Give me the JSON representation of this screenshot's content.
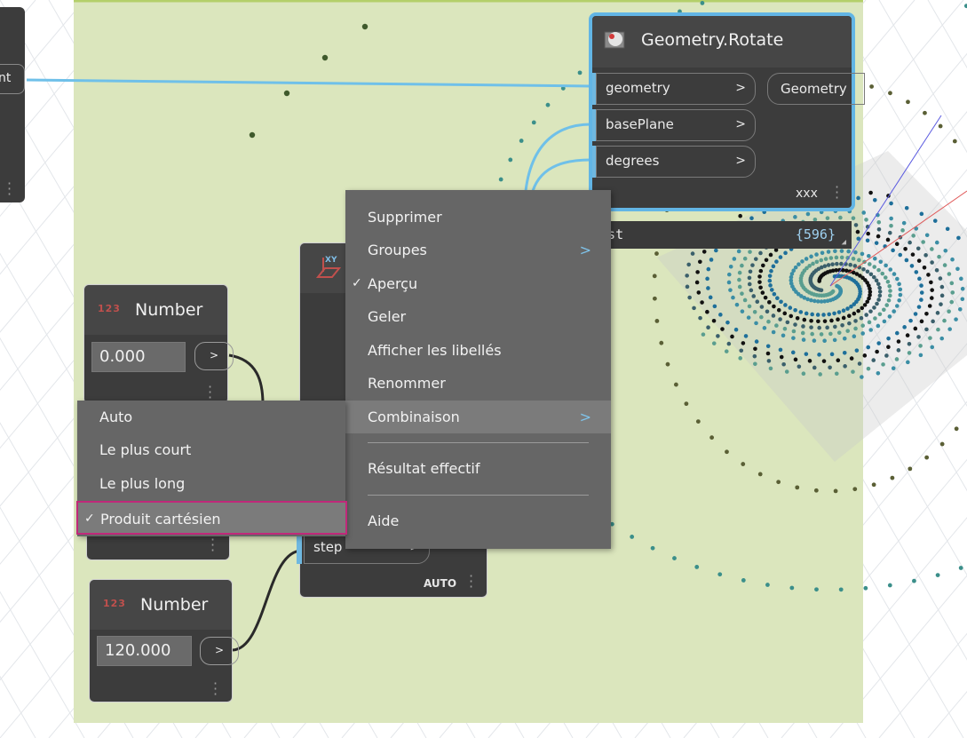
{
  "colors": {
    "canvas_bg": "#ffffff",
    "group_bg": "#dbe6bd",
    "node_bg": "#3c3c3c",
    "node_header": "#545454",
    "selection_border": "#62b5e5",
    "wire": "#6fc0e9",
    "menu_bg": "#666666",
    "menu_highlight": "#7b7b7b",
    "highlight_box": "#c0297a",
    "number_icon": "#c0504d"
  },
  "left_node": {
    "port_text": "nt"
  },
  "rotate_node": {
    "title": "Geometry.Rotate",
    "icon": "geometry-rotate-icon",
    "inputs": [
      {
        "label": "geometry",
        "chevron": ">"
      },
      {
        "label": "basePlane",
        "chevron": ">"
      },
      {
        "label": "degrees",
        "chevron": ">"
      }
    ],
    "output": "Geometry",
    "lacing": "xxx",
    "preview": {
      "label": "List",
      "count": "{596}"
    }
  },
  "number_node_1": {
    "icon_text": "123",
    "title": "Number",
    "value": "0.000",
    "arrow": ">"
  },
  "number_node_2": {
    "icon_text": "123",
    "title": "Number",
    "value": "120.000",
    "arrow": ">"
  },
  "middle_node": {
    "icon_text": "XY",
    "port_label": "step",
    "port_chevron": ">",
    "lacing": "AUTO"
  },
  "context_menu": {
    "items": [
      {
        "label": "Supprimer",
        "checked": false,
        "submenu": false
      },
      {
        "label": "Groupes",
        "checked": false,
        "submenu": true
      },
      {
        "label": "Aperçu",
        "checked": true,
        "submenu": false
      },
      {
        "label": "Geler",
        "checked": false,
        "submenu": false
      },
      {
        "label": "Afficher les libellés",
        "checked": false,
        "submenu": false
      },
      {
        "label": "Renommer",
        "checked": false,
        "submenu": false
      },
      {
        "label": "Combinaison",
        "checked": false,
        "submenu": true,
        "highlighted": true
      },
      {
        "label": "Résultat effectif",
        "checked": false,
        "submenu": false
      },
      {
        "label": "Aide",
        "checked": false,
        "submenu": false
      }
    ],
    "check_glyph": "✓",
    "submenu_glyph": ">"
  },
  "lacing_submenu": {
    "items": [
      {
        "label": "Auto",
        "checked": false
      },
      {
        "label": "Le plus court",
        "checked": false
      },
      {
        "label": "Le plus long",
        "checked": false
      },
      {
        "label": "Produit cartésien",
        "checked": true
      }
    ],
    "check_glyph": "✓"
  }
}
